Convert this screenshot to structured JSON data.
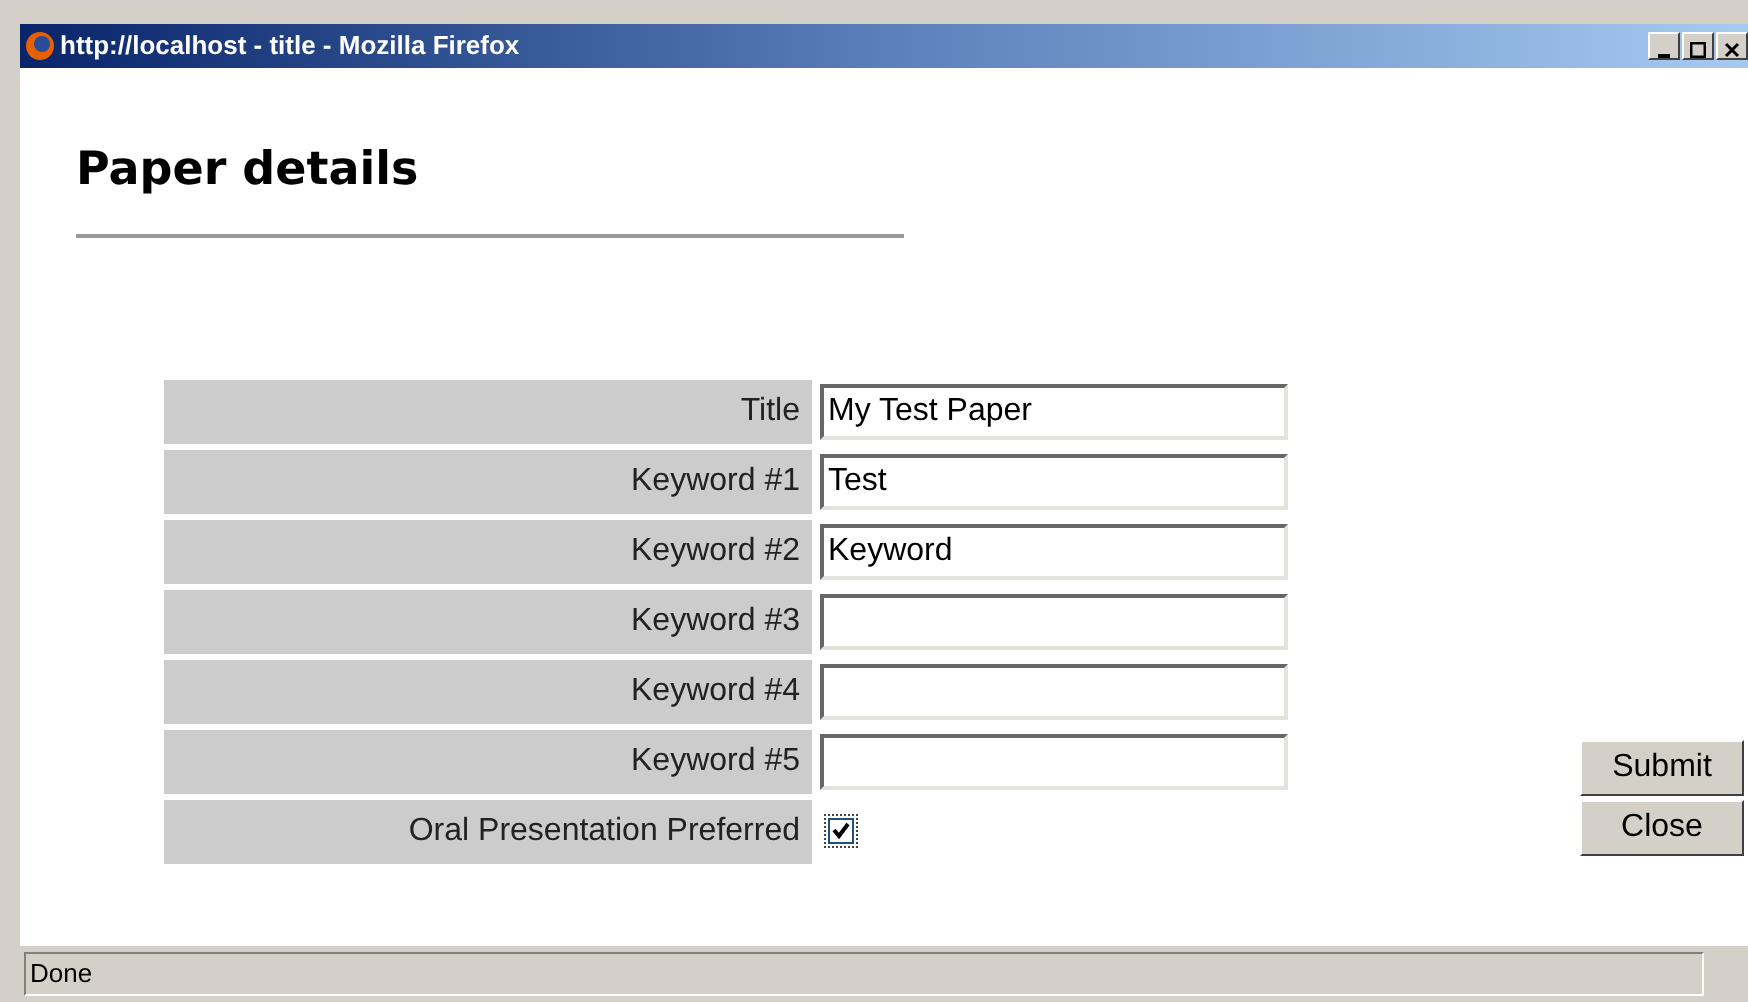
{
  "window": {
    "title": "http://localhost - title - Mozilla Firefox"
  },
  "heading": "Paper details",
  "fields": [
    {
      "kind": "text",
      "label": "Title",
      "value": "My Test Paper"
    },
    {
      "kind": "text",
      "label": "Keyword #1",
      "value": "Test"
    },
    {
      "kind": "text",
      "label": "Keyword #2",
      "value": "Keyword"
    },
    {
      "kind": "text",
      "label": "Keyword #3"
    },
    {
      "kind": "text",
      "label": "Keyword #4"
    },
    {
      "kind": "text",
      "label": "Keyword #5"
    },
    {
      "kind": "checkbox",
      "label": "Oral Presentation Preferred",
      "checked": true
    }
  ],
  "buttons": [
    "Submit",
    "Close"
  ],
  "status_bar": "Done"
}
